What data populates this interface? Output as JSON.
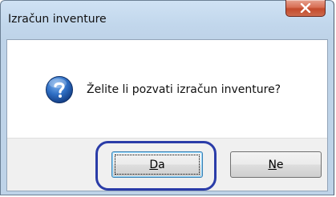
{
  "window": {
    "title": "Izračun inventure"
  },
  "dialog": {
    "icon": "question-icon",
    "message": "Želite li pozvati izračun inventure?"
  },
  "buttons": {
    "yes": {
      "mnemonic": "D",
      "rest": "a",
      "default": true
    },
    "no": {
      "mnemonic": "N",
      "rest": "e",
      "default": false
    }
  },
  "annotation": {
    "shape": "rounded-rectangle",
    "color": "#2a3ca8",
    "target": "yes-button"
  },
  "colors": {
    "title_bar": "#c2d7ec",
    "close_button": "#c34a2c",
    "footer": "#f0f0f0",
    "default_button_border": "#3c7fb1"
  }
}
